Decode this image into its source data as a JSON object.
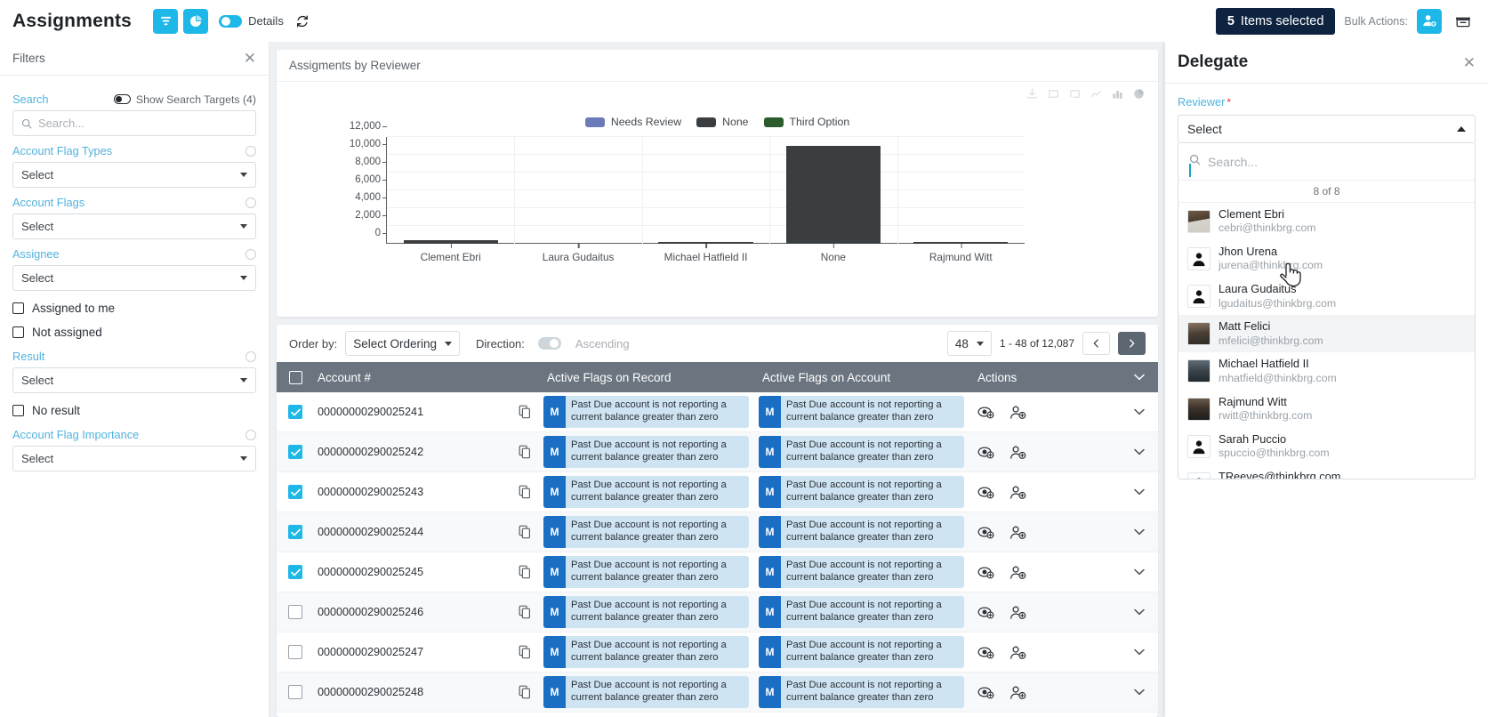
{
  "header": {
    "title": "Assignments",
    "filter_icon": "filter-icon",
    "chart_icon": "pie-chart-icon",
    "details_label": "Details",
    "refresh_icon": "refresh-icon",
    "selected_count": "5",
    "selected_label": "Items selected",
    "bulk_actions_label": "Bulk Actions:",
    "bulk_delegate_icon": "person-add-icon",
    "bulk_archive_icon": "archive-icon",
    "accent": "#1eb8e8",
    "chip_bg": "#0d2340"
  },
  "filters": {
    "title": "Filters",
    "close_icon": "close-icon",
    "search": {
      "label": "Search",
      "toggle_label": "Show Search Targets (4)",
      "placeholder": "Search...",
      "value": ""
    },
    "groups": [
      {
        "label": "Account Flag Types",
        "value": "Select"
      },
      {
        "label": "Account Flags",
        "value": "Select"
      },
      {
        "label": "Assignee",
        "value": "Select"
      }
    ],
    "checkboxes_top": [
      {
        "label": "Assigned to me",
        "checked": false
      },
      {
        "label": "Not assigned",
        "checked": false
      }
    ],
    "result": {
      "label": "Result",
      "value": "Select"
    },
    "checkboxes_mid": [
      {
        "label": "No result",
        "checked": false
      }
    ],
    "importance": {
      "label": "Account Flag Importance",
      "value": "Select"
    },
    "label_color": "#52b2dd"
  },
  "chart_card": {
    "title": "Assigments by Reviewer",
    "tools": [
      "download-icon",
      "box-select-icon",
      "lasso-select-icon",
      "zoom-reset-icon",
      "bar-chart-icon",
      "pie-chart-icon"
    ]
  },
  "chart_data": {
    "type": "bar",
    "title": "Assigments by Reviewer",
    "categories": [
      "Clement Ebri",
      "Laura Gudaitus",
      "Michael Hatfield II",
      "None",
      "Rajmund Witt"
    ],
    "series": [
      {
        "name": "Needs Review",
        "color": "#6b7ab8",
        "values": [
          0,
          0,
          0,
          0,
          0
        ]
      },
      {
        "name": "None",
        "color": "#3b3e40",
        "values": [
          420,
          0,
          180,
          11000,
          200
        ]
      },
      {
        "name": "Third Option",
        "color": "#2c5c2e",
        "values": [
          0,
          0,
          0,
          0,
          0
        ]
      }
    ],
    "xlabel": "",
    "ylabel": "",
    "ylim": [
      0,
      12000
    ],
    "yticks": [
      "0",
      "2,000",
      "4,000",
      "6,000",
      "8,000",
      "10,000",
      "12,000"
    ],
    "grid": true,
    "legend_position": "top-center"
  },
  "table_controls": {
    "order_by_label": "Order by:",
    "order_by_value": "Select Ordering",
    "direction_label": "Direction:",
    "direction_value": "Ascending",
    "page_size": "48",
    "range_text": "1 - 48 of 12,087",
    "prev_icon": "chevron-left-icon",
    "next_icon": "chevron-right-icon"
  },
  "table": {
    "columns": [
      "Account #",
      "Active Flags on Record",
      "Active Flags on Account",
      "Actions"
    ],
    "flag_marker": "M",
    "flag_text": "Past Due account is not reporting a current balance greater than zero",
    "copy_icon": "copy-icon",
    "action_icons": [
      "flag-review-icon",
      "assign-user-icon"
    ],
    "expand_icon": "chevron-down-icon",
    "rows": [
      {
        "account": "00000000290025241",
        "checked": true
      },
      {
        "account": "00000000290025242",
        "checked": true
      },
      {
        "account": "00000000290025243",
        "checked": true
      },
      {
        "account": "00000000290025244",
        "checked": true
      },
      {
        "account": "00000000290025245",
        "checked": true
      },
      {
        "account": "00000000290025246",
        "checked": false
      },
      {
        "account": "00000000290025247",
        "checked": false
      },
      {
        "account": "00000000290025248",
        "checked": false
      }
    ]
  },
  "delegate": {
    "title": "Delegate",
    "close_icon": "close-icon",
    "reviewer_label": "Reviewer",
    "required_mark": "*",
    "select_value": "Select",
    "search_placeholder": "Search...",
    "count_text": "8 of 8",
    "reviewers": [
      {
        "name": "Clement Ebri",
        "email": "cebri@thinkbrg.com",
        "avatar": "photo",
        "photo_class": "p1"
      },
      {
        "name": "Jhon Urena",
        "email": "jurena@thinkbrg.com",
        "avatar": "placeholder",
        "photo_class": ""
      },
      {
        "name": "Laura Gudaitus",
        "email": "lgudaitus@thinkbrg.com",
        "avatar": "placeholder",
        "photo_class": ""
      },
      {
        "name": "Matt Felici",
        "email": "mfelici@thinkbrg.com",
        "avatar": "photo",
        "photo_class": "p3"
      },
      {
        "name": "Michael Hatfield II",
        "email": "mhatfield@thinkbrg.com",
        "avatar": "photo",
        "photo_class": "p2"
      },
      {
        "name": "Rajmund Witt",
        "email": "rwitt@thinkbrg.com",
        "avatar": "photo",
        "photo_class": "p4"
      },
      {
        "name": "Sarah Puccio",
        "email": "spuccio@thinkbrg.com",
        "avatar": "placeholder",
        "photo_class": ""
      },
      {
        "name": "TReeves@thinkbrg.com",
        "email": "treeves@thinkbrg.com",
        "avatar": "placeholder",
        "photo_class": ""
      }
    ],
    "hovered_index": 3
  }
}
